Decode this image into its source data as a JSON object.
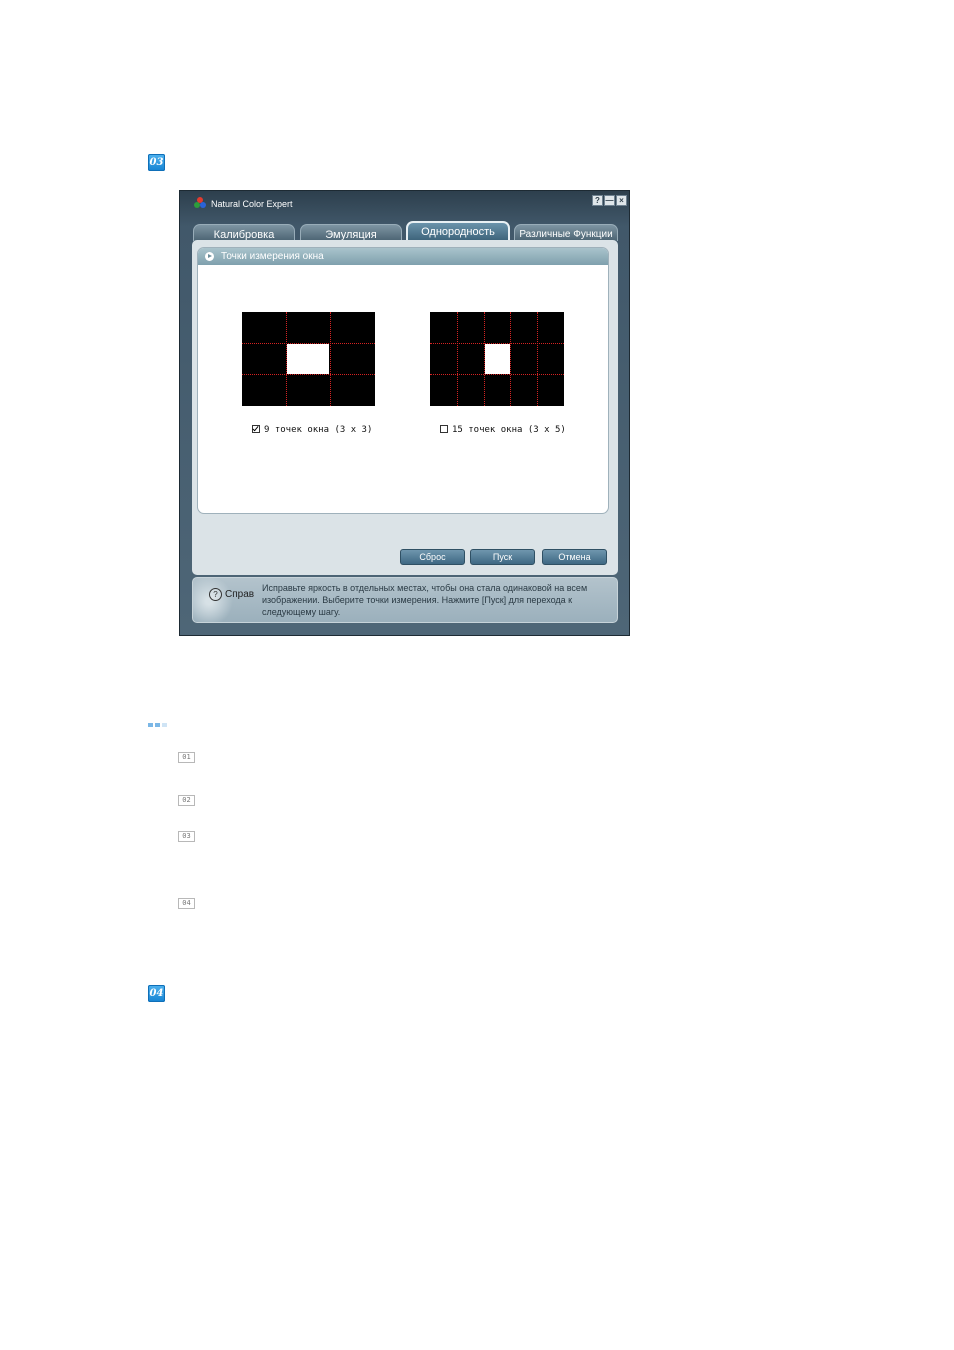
{
  "steps": {
    "badge_1": "03",
    "badge_2": "04"
  },
  "window": {
    "title": "Natural Color Expert",
    "controls": {
      "help": "?",
      "minimize": "—",
      "close": "×"
    },
    "tabs": [
      {
        "label": "Калибровка"
      },
      {
        "label": "Эмуляция"
      },
      {
        "label": "Однородность",
        "active": true
      },
      {
        "label": "Различные Функции"
      }
    ],
    "panel": {
      "title": "Точки измерения окна",
      "options": [
        {
          "label": "9 точек окна (3 x 3)",
          "checked": true
        },
        {
          "label": "15 точек окна (3 x 5)",
          "checked": false
        }
      ]
    },
    "buttons": {
      "reset": "Сброс",
      "start": "Пуск",
      "cancel": "Отмена"
    },
    "help": {
      "label": "Справ",
      "icon": "?",
      "text": "Исправьте яркость в отдельных местах, чтобы она стала одинаковой на всем изображении. Выберите точки измерения. Нажмите [Пуск] для перехода к следующему шагу."
    }
  },
  "list_numbers": [
    "01",
    "02",
    "03",
    "04"
  ],
  "colors": {
    "accent_blue": "#1583d3",
    "grid_line": "#d52222",
    "window_bg": "#4e6677"
  },
  "icons": [
    "help-icon",
    "minimize-icon",
    "close-icon",
    "play-icon",
    "checkbox-icon"
  ]
}
